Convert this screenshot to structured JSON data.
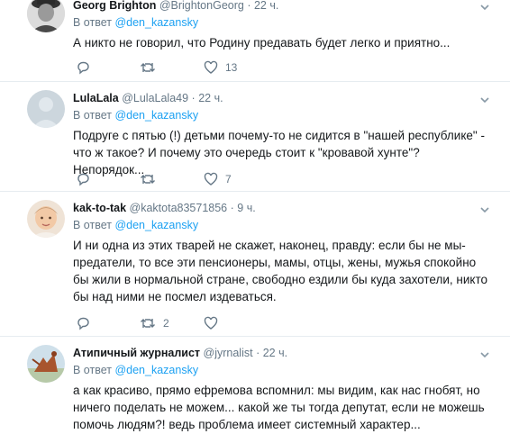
{
  "tweets": [
    {
      "fullname": "Georg Brighton",
      "username": "@BrightonGeorg",
      "sep": "·",
      "time": "22 ч.",
      "reply_prefix": "В ответ",
      "reply_handle": "@den_kazansky",
      "text": "А никто не говорил, что Родину предавать будет легко и приятно...",
      "reply_count": "",
      "retweet_count": "",
      "like_count": "13"
    },
    {
      "fullname": "LulaLala",
      "username": "@LulaLala49",
      "sep": "·",
      "time": "22 ч.",
      "reply_prefix": "В ответ",
      "reply_handle": "@den_kazansky",
      "text": "Подруге с пятью (!) детьми почему-то не сидится в \"нашей республике\" - что ж такое? И почему это очередь стоит к \"кровавой хунте\"? Непорядок...",
      "reply_count": "",
      "retweet_count": "",
      "like_count": "7"
    },
    {
      "fullname": "kak-to-tak",
      "username": "@kaktota83571856",
      "sep": "·",
      "time": "9 ч.",
      "reply_prefix": "В ответ",
      "reply_handle": "@den_kazansky",
      "text": "И ни одна из этих тварей не скажет, наконец, правду: если бы не мы-предатели, то все эти пенсионеры, мамы, отцы, жены, мужья спокойно бы жили в нормальной стране, свободно ездили бы куда захотели, никто бы над ними не посмел издеваться.",
      "reply_count": "",
      "retweet_count": "2",
      "like_count": ""
    },
    {
      "fullname": "Атипичный журналист",
      "username": "@jyrnalist",
      "sep": "·",
      "time": "22 ч.",
      "reply_prefix": "В ответ",
      "reply_handle": "@den_kazansky",
      "text": "а как красиво, прямо ефремова вспомнил: мы видим, как нас гнобят, но ничего поделать не можем... какой же ты тогда депутат, если не можешь помочь людям?! ведь проблема имеет системный характер...",
      "reply_count": "",
      "retweet_count": "",
      "like_count": ""
    }
  ],
  "colors": {
    "link": "#1da1f2",
    "secondary": "#657786",
    "border": "#e6ecf0"
  }
}
